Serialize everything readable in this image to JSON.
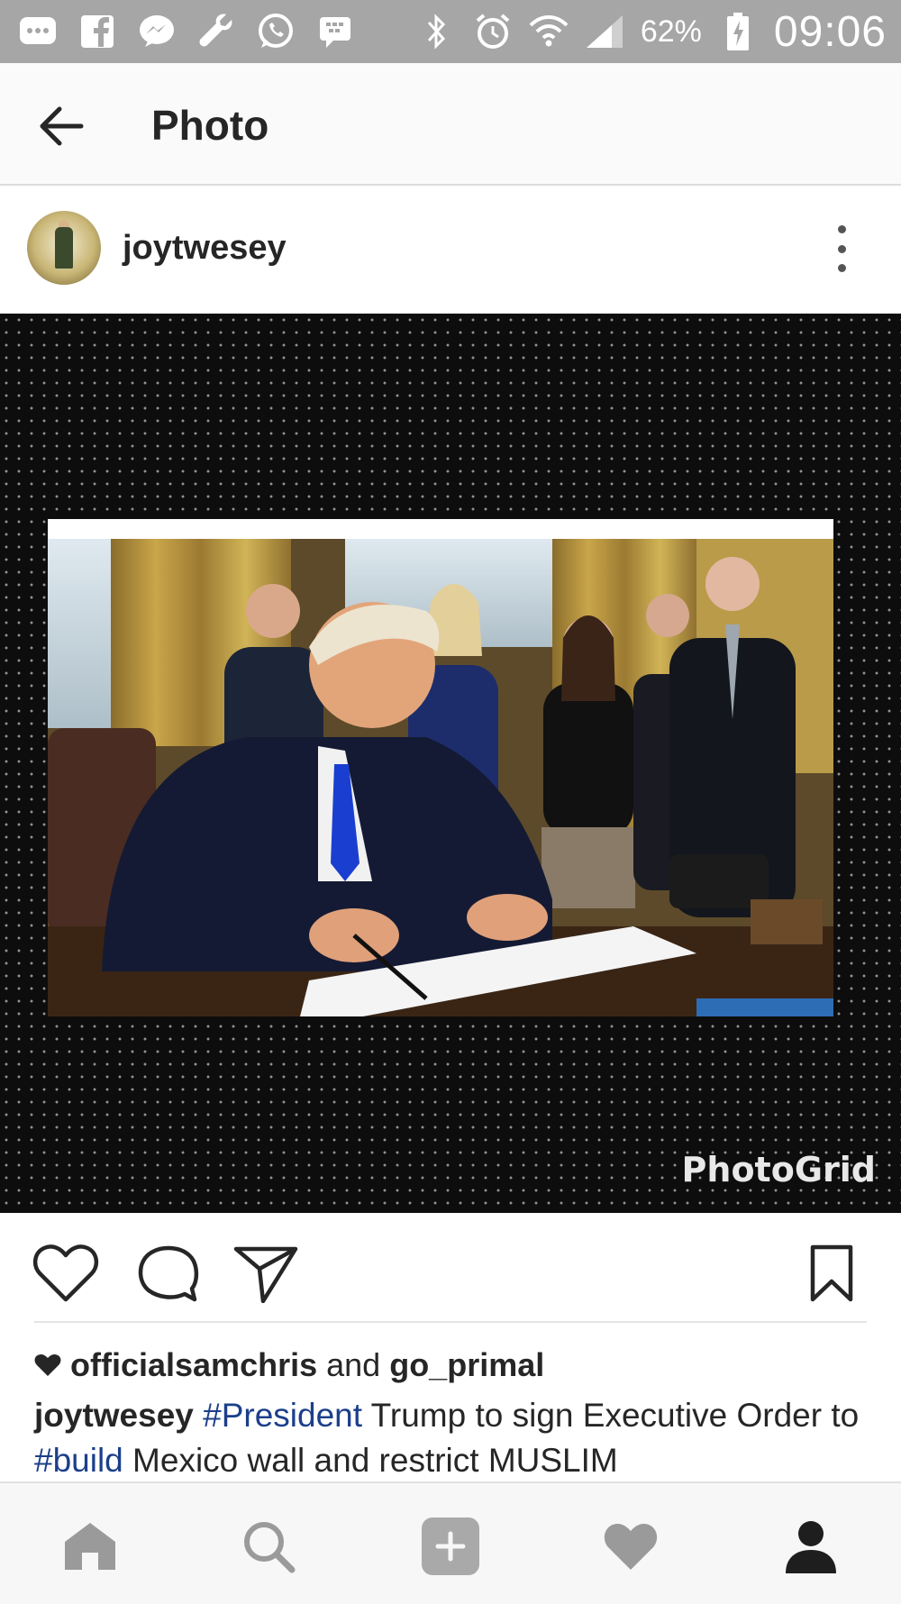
{
  "status_bar": {
    "battery": "62%",
    "clock": "09:06",
    "left_icons": [
      "chat-bubble-icon",
      "facebook-icon",
      "messenger-icon",
      "wrench-icon",
      "whatsapp-icon",
      "bbm-icon"
    ],
    "right_icons": [
      "bluetooth-icon",
      "alarm-icon",
      "wifi-icon",
      "signal-icon",
      "battery-charging-icon"
    ]
  },
  "app_bar": {
    "title": "Photo",
    "back_icon": "arrow-left-icon"
  },
  "post": {
    "username": "joytwesey",
    "more_icon": "vertical-dots-icon",
    "watermark": "PhotoGrid",
    "likes": {
      "heart_icon": "heart-filled-icon",
      "user_one": "officialsamchris",
      "joiner": "and",
      "user_two": "go_primal"
    },
    "caption": {
      "author": "joytwesey",
      "tag_one": "#President",
      "text_one": "Trump to sign Executive Order to",
      "tag_two": "#build",
      "text_two": "Mexico wall and restrict MUSLIM"
    }
  },
  "actions": {
    "like_icon": "heart-outline-icon",
    "comment_icon": "comment-icon",
    "share_icon": "send-icon",
    "save_icon": "bookmark-icon"
  },
  "bottom_nav": [
    "home-icon",
    "search-icon",
    "add-icon",
    "activity-heart-icon",
    "profile-icon"
  ],
  "colors": {
    "status_bar": "#a6a6a6",
    "hashtag": "#1c3f8a",
    "photo_background": "#0d0d0d"
  }
}
